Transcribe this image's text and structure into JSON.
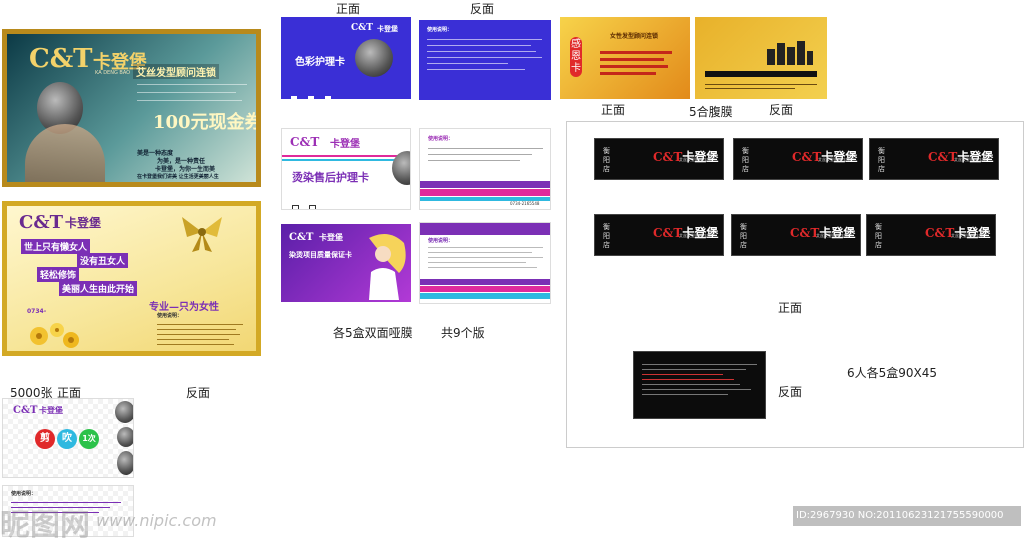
{
  "labels": {
    "front_top": "正面",
    "back_top": "反面",
    "front_gold": "正面",
    "fold_membrane": "5合腹膜",
    "back_gold": "反面",
    "double_matte": "各5盒双面哑膜",
    "nine_versions": "共9个版",
    "qty_5000": "5000张",
    "qty_front": "正面",
    "qty_back": "反面",
    "biz_front": "正面",
    "biz_back": "反面",
    "biz_spec": "6人各5盒90X45"
  },
  "cards": {
    "teal": {
      "logo": "C&T",
      "brand": "卡登堡",
      "pinyin": "KA DENG BAO",
      "banner": "艾丝发型顾问连锁",
      "coupon": "100元现金券",
      "slogan1": "美是一种态度",
      "slogan2": "为美，是一种责任",
      "slogan3": "卡登堡，为你一生而美",
      "slogan4": "在卡登堡我们讲美 让生活更美丽人生"
    },
    "gold": {
      "logo": "C&T",
      "brand": "卡登堡",
      "tag1": "世上只有懒女人",
      "tag2": "没有丑女人",
      "tag3": "轻松修饰",
      "tag4": "美丽人生由此开始",
      "phone": "0734-",
      "specialty": "专业—只为女性",
      "notes_title": "使用说明："
    },
    "color_care": {
      "logo": "C&T",
      "brand": "卡登堡",
      "title": "色彩护理卡"
    },
    "perm_care": {
      "logo": "C&T",
      "brand": "卡登堡",
      "title": "烫染售后护理卡"
    },
    "quality": {
      "logo": "C&T",
      "brand": "卡登堡",
      "title": "染烫项目质量保证卡"
    },
    "back_title": "使用说明：",
    "phone": "0734-2165548",
    "gold_card": {
      "vertical": "感恩卡",
      "heading": "女性发型顾问连锁"
    },
    "punch": {
      "logo": "C&T",
      "brand": "卡登堡",
      "btn1": "剪",
      "btn2": "吹",
      "btn3": "1次",
      "back_title": "使用说明："
    }
  },
  "biz_cards": [
    {
      "store": "衡阳店"
    },
    {
      "store": "衡阳店"
    },
    {
      "store": "衡阳店"
    },
    {
      "store": "衡阳店"
    },
    {
      "store": "衡阳店"
    },
    {
      "store": "衡阳店"
    }
  ],
  "biz_logo": "C&T",
  "biz_brand": "卡登堡",
  "biz_sub": "艾丝发型顾问连锁",
  "watermark": {
    "logo": "昵图网",
    "url": "www.nipic.com",
    "id": "ID:2967930 NO:20110623121755590000"
  },
  "colors": {
    "blue": "#3a2fd6",
    "purple": "#7b2fb5",
    "gold": "#e6b21f",
    "black": "#0c0c0c",
    "red": "#e0292a"
  }
}
